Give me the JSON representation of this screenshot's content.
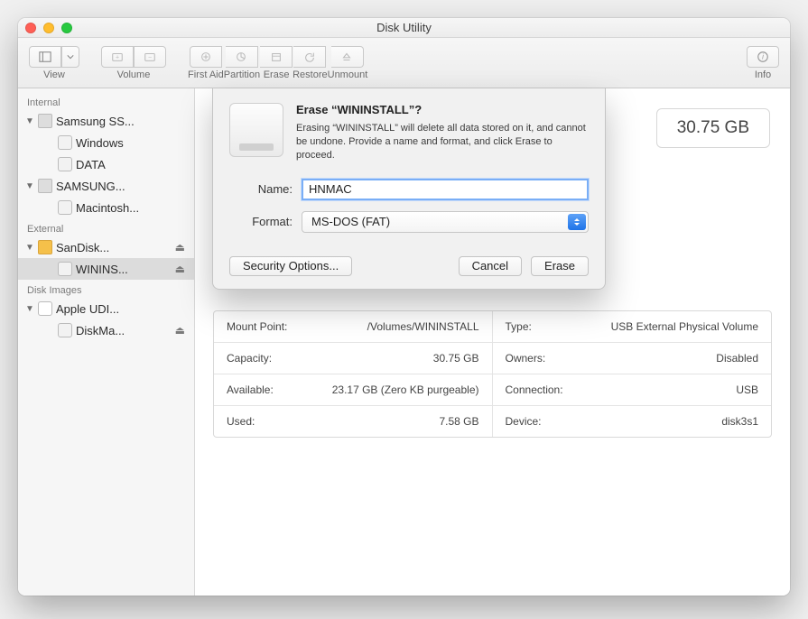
{
  "window": {
    "title": "Disk Utility"
  },
  "toolbar": {
    "view": "View",
    "volume": "Volume",
    "firstaid": "First Aid",
    "partition": "Partition",
    "erase": "Erase",
    "restore": "Restore",
    "unmount": "Unmount",
    "info": "Info"
  },
  "sidebar": {
    "internal": "Internal",
    "external": "External",
    "diskimages": "Disk Images",
    "items": [
      {
        "label": "Samsung SS..."
      },
      {
        "label": "Windows"
      },
      {
        "label": "DATA"
      },
      {
        "label": "SAMSUNG..."
      },
      {
        "label": "Macintosh..."
      },
      {
        "label": "SanDisk..."
      },
      {
        "label": "WININS..."
      },
      {
        "label": "Apple UDI..."
      },
      {
        "label": "DiskMa..."
      }
    ]
  },
  "main": {
    "size": "30.75 GB",
    "info": {
      "mountpoint_l": "Mount Point:",
      "mountpoint_v": "/Volumes/WININSTALL",
      "capacity_l": "Capacity:",
      "capacity_v": "30.75 GB",
      "available_l": "Available:",
      "available_v": "23.17 GB (Zero KB purgeable)",
      "used_l": "Used:",
      "used_v": "7.58 GB",
      "type_l": "Type:",
      "type_v": "USB External Physical Volume",
      "owners_l": "Owners:",
      "owners_v": "Disabled",
      "connection_l": "Connection:",
      "connection_v": "USB",
      "device_l": "Device:",
      "device_v": "disk3s1"
    }
  },
  "sheet": {
    "title": "Erase “WININSTALL”?",
    "desc": "Erasing “WININSTALL” will delete all data stored on it, and cannot be undone. Provide a name and format, and click Erase to proceed.",
    "name_label": "Name:",
    "name_value": "HNMAC",
    "format_label": "Format:",
    "format_value": "MS-DOS (FAT)",
    "security": "Security Options...",
    "cancel": "Cancel",
    "erase": "Erase"
  }
}
